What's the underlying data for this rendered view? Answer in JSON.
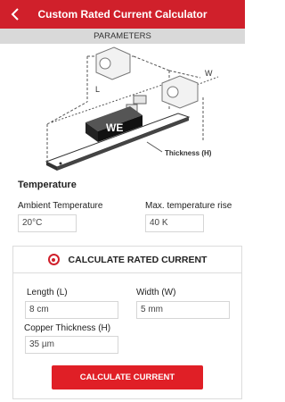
{
  "header": {
    "title": "Custom Rated Current Calculator"
  },
  "subheader": {
    "label": "PARAMETERS"
  },
  "diagram": {
    "label_l": "L",
    "label_w": "W",
    "label_thickness": "Thickness (H)",
    "logo_text": "WE"
  },
  "temperature": {
    "section_title": "Temperature",
    "ambient_label": "Ambient Temperature",
    "ambient_value": "20°C",
    "rise_label": "Max. temperature rise",
    "rise_value": "40 K"
  },
  "calculate": {
    "title": "CALCULATE RATED CURRENT",
    "length_label": "Length (L)",
    "length_value": "8 cm",
    "width_label": "Width (W)",
    "width_value": "5 mm",
    "thickness_label": "Copper Thickness (H)",
    "thickness_value": "35 µm",
    "button_label": "CALCULATE CURRENT"
  },
  "colors": {
    "accent": "#d0202b",
    "button": "#e01f26",
    "subbar": "#d9d9d9"
  },
  "icons": {
    "back": "chevron-left-icon",
    "radio": "radio-selected-icon"
  }
}
